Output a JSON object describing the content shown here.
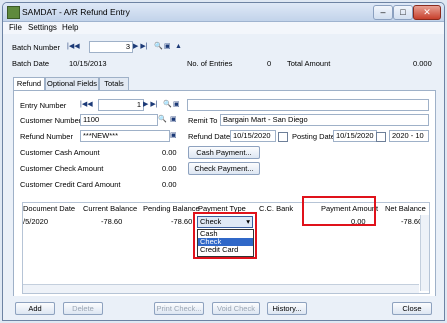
{
  "window": {
    "title": "SAMDAT - A/R Refund Entry"
  },
  "menu": {
    "file": "File",
    "settings": "Settings",
    "help": "Help"
  },
  "batch": {
    "number_label": "Batch Number",
    "number_value": "3",
    "date_label": "Batch Date",
    "date_value": "10/15/2013",
    "entries_label": "No. of Entries",
    "entries_value": "0",
    "total_label": "Total Amount",
    "total_value": "0.000"
  },
  "tabs": [
    "Refund",
    "Optional Fields",
    "Totals"
  ],
  "entry": {
    "entry_number_label": "Entry Number",
    "entry_number_value": "1",
    "customer_label": "Customer Number",
    "customer_value": "1100",
    "remit_label": "Remit To",
    "remit_value": "Bargain Mart - San Diego",
    "refund_number_label": "Refund Number",
    "refund_number_value": "***NEW***",
    "refund_date_label": "Refund Date",
    "refund_date_value": "10/15/2020",
    "posting_label": "Posting Date",
    "posting_value": "10/15/2020",
    "period_value": "2020 - 10",
    "cash_label": "Customer Cash Amount",
    "cash_value": "0.00",
    "check_label": "Customer Check Amount",
    "check_value": "0.00",
    "cc_label": "Customer Credit Card Amount",
    "cc_value": "0.00",
    "cash_payment_button": "Cash Payment...",
    "check_payment_button": "Check Payment..."
  },
  "grid": {
    "headers": [
      "Document Date",
      "Current Balance",
      "Pending Balance",
      "Payment Type",
      "C.C. Bank",
      "Payment Amount",
      "Net Balance"
    ],
    "row": [
      "/5/2020",
      "-78.60",
      "-78.60",
      "Check",
      "",
      "0.00",
      "-78.60"
    ],
    "dropdown_options": [
      "Cash",
      "Check",
      "Credit Card"
    ],
    "dropdown_selected": "Check"
  },
  "footer": {
    "add": "Add",
    "delete": "Delete",
    "print_check": "Print Check...",
    "void_check": "Void Check",
    "history": "History...",
    "close": "Close"
  }
}
